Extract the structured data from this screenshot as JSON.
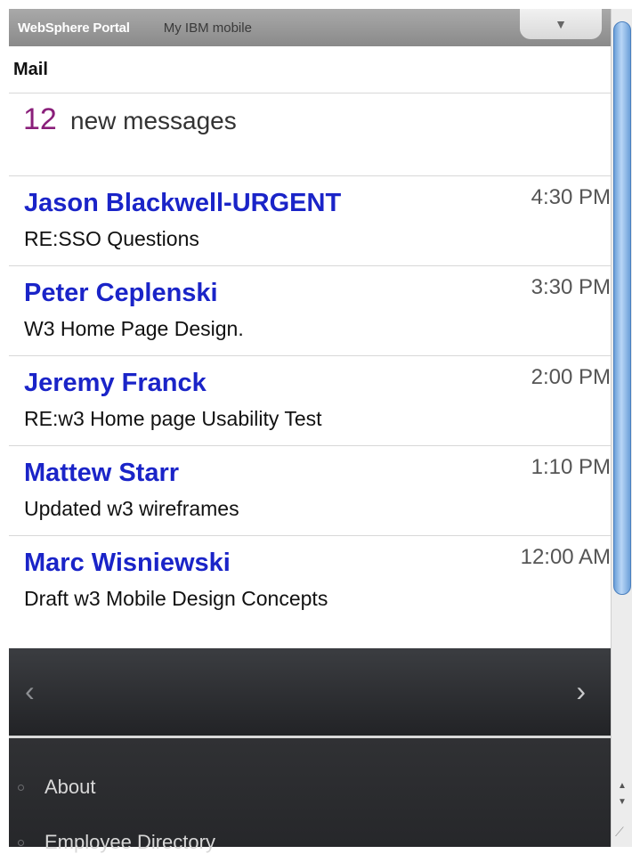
{
  "topbar": {
    "brand": "WebSphere Portal",
    "subbrand": "My IBM mobile",
    "menu_icon": "▼"
  },
  "mail": {
    "title": "Mail",
    "new_count": "12",
    "new_label": "new messages"
  },
  "messages": [
    {
      "from": "Jason Blackwell-URGENT",
      "subject": "RE:SSO Questions",
      "time": "4:30 PM"
    },
    {
      "from": "Peter Ceplenski",
      "subject": "W3 Home Page Design.",
      "time": "3:30 PM"
    },
    {
      "from": "Jeremy Franck",
      "subject": "RE:w3 Home page Usability Test",
      "time": "2:00 PM"
    },
    {
      "from": "Mattew Starr",
      "subject": "Updated w3 wireframes",
      "time": "1:10 PM"
    },
    {
      "from": "Marc Wisniewski",
      "subject": "Draft w3 Mobile Design Concepts",
      "time": "12:00 AM"
    }
  ],
  "pager": {
    "prev": "‹",
    "next": "›"
  },
  "footer": {
    "links": [
      "About",
      "Employee Directory"
    ]
  },
  "scrollbar": {
    "up": "▲",
    "down": "▼",
    "grip": "⟋"
  },
  "colors": {
    "sender": "#1a24c8",
    "count": "#8a1f7a"
  }
}
